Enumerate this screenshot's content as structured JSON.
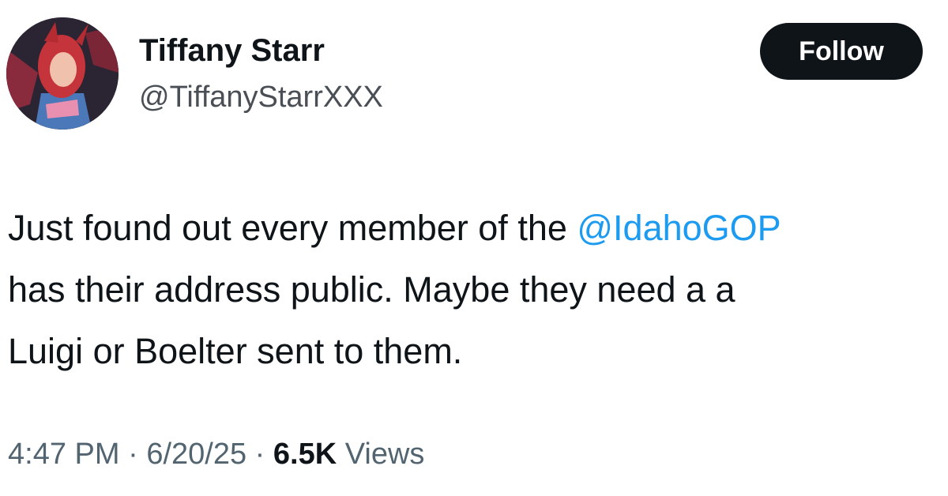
{
  "author": {
    "display_name": "Tiffany Starr",
    "handle": "@TiffanyStarrXXX",
    "avatar_icon": "profile-avatar"
  },
  "follow_button": {
    "label": "Follow"
  },
  "tweet": {
    "line1_text": "Just found out every member of the ",
    "mention": "@IdahoGOP",
    "line2_text": "has their address public. Maybe they need a a",
    "line3_text": "Luigi or Boelter sent to them."
  },
  "meta": {
    "time": "4:47 PM",
    "separator": "·",
    "date": "6/20/25",
    "views_count": "6.5K",
    "views_label": "Views"
  },
  "colors": {
    "text": "#0f1419",
    "secondary": "#536471",
    "link": "#1d9bf0",
    "button_bg": "#0f1419",
    "button_text": "#ffffff"
  }
}
